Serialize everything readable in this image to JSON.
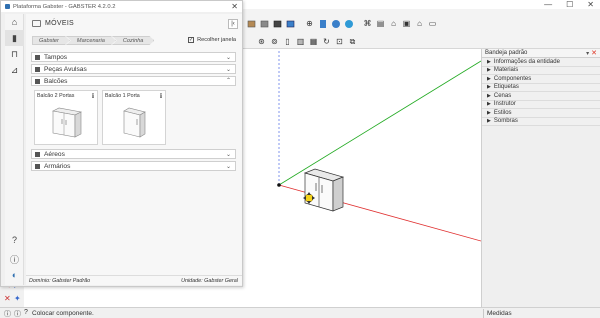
{
  "window_controls": [
    "—",
    "☐",
    "✕"
  ],
  "toolbar": {
    "row1_icons": [
      "box-icon",
      "box-icon",
      "box-icon",
      "box-icon",
      "move-icon",
      "component-icon",
      "component-icon",
      "component-icon",
      "component-icon",
      "component-icon",
      "home-icon",
      "house-icon",
      "door-icon",
      "window-icon"
    ],
    "row2_icons": [
      "orbit-icon",
      "pan-icon",
      "section-icon",
      "section-icon",
      "section-icon",
      "rotate-icon",
      "select-icon",
      "fit-icon"
    ]
  },
  "plugin": {
    "title": "Plataforma Gabster - GABSTER 4.2.0.2",
    "section_title": "MÓVEIS",
    "breadcrumb": [
      "Gabster",
      "Marcenaria",
      "Cozinha"
    ],
    "recolher_label": "Recolher janela",
    "recolher_checked": true,
    "categories_top": [
      {
        "label": "Tampos",
        "expanded": false
      },
      {
        "label": "Peças Avulsas",
        "expanded": false
      },
      {
        "label": "Balcões",
        "expanded": true
      }
    ],
    "products": [
      {
        "name": "Balcão 2 Portas",
        "info": "i"
      },
      {
        "name": "Balcão 1 Porta",
        "info": "i"
      }
    ],
    "categories_bottom": [
      {
        "label": "Aéreos",
        "expanded": false
      },
      {
        "label": "Armários",
        "expanded": false
      }
    ],
    "footer": {
      "dominio": "Domínio: Gabster Padrão",
      "unidade": "Unidade: Gabster Geral"
    }
  },
  "tray": {
    "title": "Bandeja padrão",
    "items": [
      "Informações da entidade",
      "Materiais",
      "Componentes",
      "Etiquetas",
      "Cenas",
      "Instrutor",
      "Estilos",
      "Sombras"
    ]
  },
  "statusbar": {
    "text": "Colocar componente.",
    "medidas_label": "Medidas"
  },
  "colors": {
    "axis_red": "#e03030",
    "axis_green": "#22aa22",
    "axis_blue": "#3050e0",
    "accent_blue": "#2f6fb0"
  }
}
